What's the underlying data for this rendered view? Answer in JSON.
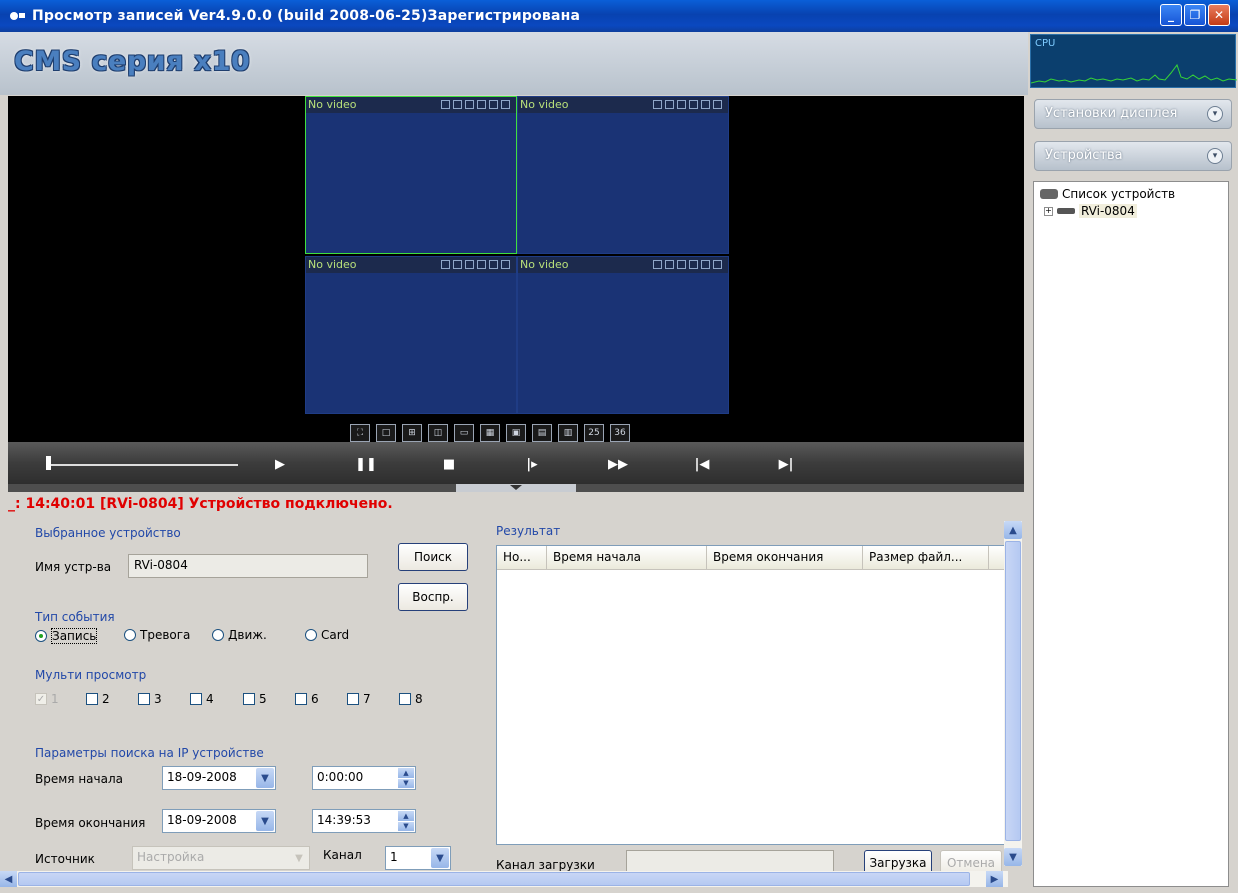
{
  "window": {
    "title": "Просмотр записей  Ver4.9.0.0 (build 2008-06-25)Зарегистрирована"
  },
  "header": {
    "logo": "CMS серия x10",
    "cpu_label": "CPU"
  },
  "video": {
    "cells": [
      {
        "label": "No video"
      },
      {
        "label": "No video"
      },
      {
        "label": "No video"
      },
      {
        "label": "No video"
      }
    ],
    "layout_buttons": [
      "",
      "",
      "",
      "",
      "",
      "",
      "",
      "",
      "",
      "25",
      "36"
    ]
  },
  "status_line": "_: 14:40:01  [RVi-0804] Устройство подключено.",
  "left_panel": {
    "selected_device_title": "Выбранное устройство",
    "device_name_label": "Имя устр-ва",
    "device_name_value": "RVi-0804",
    "search_button": "Поиск",
    "play_button": "Воспр.",
    "event_type_title": "Тип события",
    "event_types": [
      "Запись",
      "Тревога",
      "Движ.",
      "Card"
    ],
    "multi_view_title": "Мульти просмотр",
    "multi_view_channels": [
      "1",
      "2",
      "3",
      "4",
      "5",
      "6",
      "7",
      "8"
    ],
    "ip_search_title": "Параметры поиска на IP устройстве",
    "start_time_label": "Время начала",
    "start_date": "18-09-2008",
    "start_time": "0:00:00",
    "end_time_label": "Время окончания",
    "end_date": "18-09-2008",
    "end_time": "14:39:53",
    "source_label": "Источник",
    "source_value": "Настройка",
    "channel_label": "Канал",
    "channel_value": "1"
  },
  "results": {
    "title": "Результат",
    "columns": [
      "Но...",
      "Время начала",
      "Время окончания",
      "Размер файл..."
    ],
    "download_channel_label": "Канал загрузки",
    "download_button": "Загрузка",
    "cancel_button": "Отмена"
  },
  "sidebar": {
    "display_settings": "Установки дисплея",
    "devices": "Устройства",
    "tree_root": "Список устройств",
    "tree_device": "RVi-0804"
  },
  "colors": {
    "accent": "#2248a8",
    "status": "#e00000",
    "video_cell": "#1a3375",
    "active_cell_border": "#3fe03f"
  }
}
